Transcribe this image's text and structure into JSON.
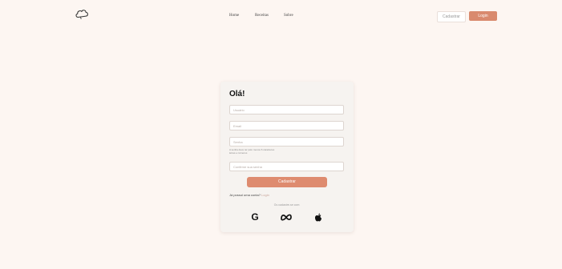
{
  "header": {
    "nav": [
      "Home",
      "Receitas",
      "Sobre"
    ],
    "cadastrar_label": "Cadastrar",
    "login_label": "Login"
  },
  "form": {
    "title": "Olá!",
    "usuario_placeholder": "Usuário",
    "email_placeholder": "Email",
    "senha_placeholder": "Senha",
    "hint_line1": "A senha deve ter pelo menos 6 caracteres",
    "hint_line2": "letras e números",
    "confirm_placeholder": "Confirme sua senha",
    "submit_label": "Cadastrar",
    "have_account_text": "Já possui uma conta?",
    "login_link": "Login",
    "or_text": "Ou cadastre-se com:"
  },
  "colors": {
    "background": "#fdf6f2",
    "accent": "#de8b6f",
    "card": "#f6f3f0"
  },
  "icons": {
    "logo": "cloud-icon",
    "social": [
      "google-icon",
      "meta-icon",
      "apple-icon"
    ]
  }
}
